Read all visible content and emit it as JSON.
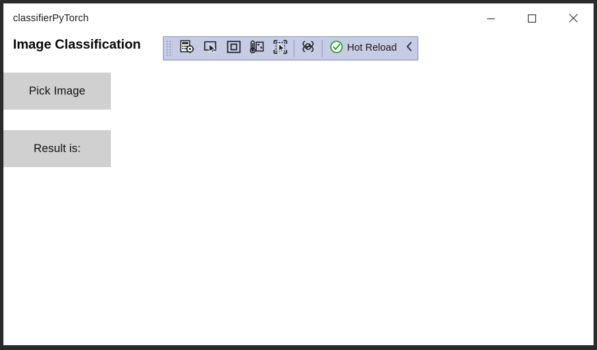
{
  "window": {
    "title": "classifierPyTorch",
    "caption_buttons": [
      {
        "name": "minimize-button",
        "label": "─",
        "tooltip": "Minimize"
      },
      {
        "name": "maximize-button",
        "label": "☐",
        "tooltip": "Maximize"
      },
      {
        "name": "close-button",
        "label": "✕",
        "tooltip": "Close"
      }
    ]
  },
  "page": {
    "title": "Image Classification"
  },
  "toolbar": {
    "name": "xaml-hot-reload-toolbar",
    "grip": "drag-grip",
    "items": [
      {
        "name": "go-to-live-visual-tree-icon",
        "tooltip": "Go to Live Visual Tree"
      },
      {
        "name": "select-element-icon",
        "tooltip": "Select Element"
      },
      {
        "name": "display-layout-adorners-icon",
        "tooltip": "Display Layout Adorners"
      },
      {
        "name": "track-focused-element-icon",
        "tooltip": "Track Focused Element"
      },
      {
        "name": "preview-selection-icon",
        "tooltip": "Preview Selection"
      },
      {
        "name": "live-preview-icon",
        "tooltip": "Live Preview"
      }
    ],
    "hot_reload": {
      "label": "Hot Reload",
      "status_icon": "check-circle-icon",
      "status_color": "#1a9b1a"
    },
    "collapse": {
      "name": "collapse-chevron-icon",
      "glyph": "‹"
    },
    "colors": {
      "background": "#c6cce4",
      "border": "#8d96bd"
    }
  },
  "main": {
    "buttons": [
      {
        "name": "pick-image-button",
        "label": "Pick Image"
      },
      {
        "name": "result-button",
        "label": "Result is:"
      }
    ],
    "button_color": "#d0d0d0"
  }
}
